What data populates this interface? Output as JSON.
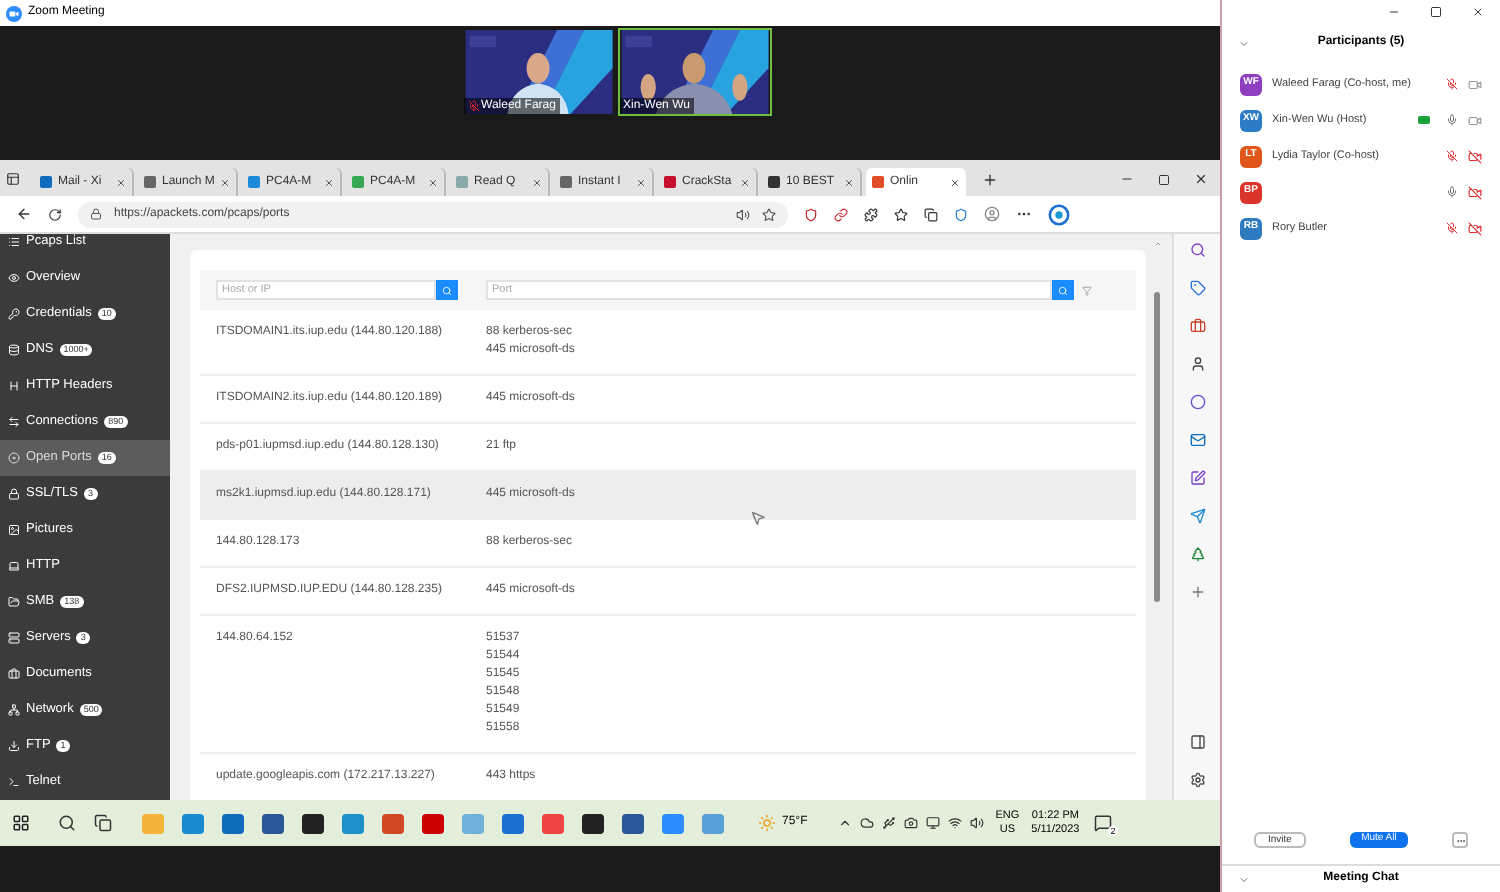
{
  "window": {
    "title": "Zoom Meeting"
  },
  "videos": [
    {
      "name": "Waleed Farag",
      "muted": true,
      "active": false
    },
    {
      "name": "Xin-Wen Wu",
      "muted": false,
      "active": true
    }
  ],
  "browser": {
    "tabs": [
      {
        "label": "Mail - Xi",
        "selected": false
      },
      {
        "label": "Launch M",
        "selected": false
      },
      {
        "label": "PC4A-M",
        "selected": false
      },
      {
        "label": "PC4A-M",
        "selected": false
      },
      {
        "label": "Read Q",
        "selected": false
      },
      {
        "label": "Instant I",
        "selected": false
      },
      {
        "label": "CrackSta",
        "selected": false
      },
      {
        "label": "10 BEST",
        "selected": false
      },
      {
        "label": "Onlin",
        "selected": true
      }
    ],
    "url": "https://apackets.com/pcaps/ports"
  },
  "sidebar": {
    "items": [
      {
        "label": "Pcaps List",
        "selected": false
      },
      {
        "label": "Overview",
        "selected": false
      },
      {
        "label": "Credentials",
        "badge": "10",
        "selected": false
      },
      {
        "label": "DNS",
        "badge": "1000+",
        "selected": false
      },
      {
        "label": "HTTP Headers",
        "selected": false
      },
      {
        "label": "Connections",
        "badge": "890",
        "selected": false
      },
      {
        "label": "Open Ports",
        "badge": "16",
        "selected": true
      },
      {
        "label": "SSL/TLS",
        "badge": "3",
        "selected": false
      },
      {
        "label": "Pictures",
        "selected": false
      },
      {
        "label": "HTTP",
        "selected": false
      },
      {
        "label": "SMB",
        "badge": "138",
        "selected": false
      },
      {
        "label": "Servers",
        "badge": "3",
        "selected": false
      },
      {
        "label": "Documents",
        "selected": false
      },
      {
        "label": "Network",
        "badge": "500",
        "selected": false
      },
      {
        "label": "FTP",
        "badge": "1",
        "selected": false
      },
      {
        "label": "Telnet",
        "selected": false
      }
    ]
  },
  "filters": {
    "host_placeholder": "Host or IP",
    "port_placeholder": "Port"
  },
  "rows": [
    {
      "host": "ITSDOMAIN1.its.iup.edu (144.80.120.188)",
      "ports": [
        "88 kerberos-sec",
        "445 microsoft-ds"
      ],
      "highlighted": false
    },
    {
      "host": "ITSDOMAIN2.its.iup.edu (144.80.120.189)",
      "ports": [
        "445 microsoft-ds"
      ],
      "highlighted": false
    },
    {
      "host": "pds-p01.iupmsd.iup.edu (144.80.128.130)",
      "ports": [
        "21 ftp"
      ],
      "highlighted": false
    },
    {
      "host": "ms2k1.iupmsd.iup.edu (144.80.128.171)",
      "ports": [
        "445 microsoft-ds"
      ],
      "highlighted": true
    },
    {
      "host": "144.80.128.173",
      "ports": [
        "88 kerberos-sec"
      ],
      "highlighted": false
    },
    {
      "host": "DFS2.IUPMSD.IUP.EDU (144.80.128.235)",
      "ports": [
        "445 microsoft-ds"
      ],
      "highlighted": false
    },
    {
      "host": "144.80.64.152",
      "ports": [
        "51537",
        "51544",
        "51545",
        "51548",
        "51549",
        "51558"
      ],
      "highlighted": false
    },
    {
      "host": "update.googleapis.com (172.217.13.227)",
      "ports": [
        "443 https"
      ],
      "highlighted": false
    }
  ],
  "participants": {
    "title": "Participants (5)",
    "people": [
      {
        "initials": "WF",
        "name": "Waleed Farag (Co-host, me)",
        "color": "#8e3fc0",
        "mic_muted": true,
        "video_off": false,
        "sharing": false
      },
      {
        "initials": "XW",
        "name": "Xin-Wen Wu (Host)",
        "color": "#2b7cc4",
        "mic_muted": false,
        "video_off": false,
        "sharing": true
      },
      {
        "initials": "LT",
        "name": "Lydia Taylor (Co-host)",
        "color": "#e0561b",
        "mic_muted": true,
        "video_off": true,
        "sharing": false
      },
      {
        "initials": "BP",
        "color": "#d8342a",
        "mic_muted": false,
        "video_off": true,
        "sharing": false
      },
      {
        "initials": "RB",
        "name": "Rory Butler",
        "color": "#2e7bbf",
        "mic_muted": true,
        "video_off": true,
        "sharing": false
      }
    ]
  },
  "buttons": [
    {
      "label": "Invite",
      "kind": "outline"
    },
    {
      "label": "Mute All",
      "kind": "primary"
    }
  ],
  "chat": {
    "title": "Meeting Chat"
  },
  "taskbar": {
    "weather": "75°F",
    "language": "ENG",
    "region": "US",
    "time": "01:22 PM",
    "date": "5/11/2023",
    "notifications": "2"
  }
}
